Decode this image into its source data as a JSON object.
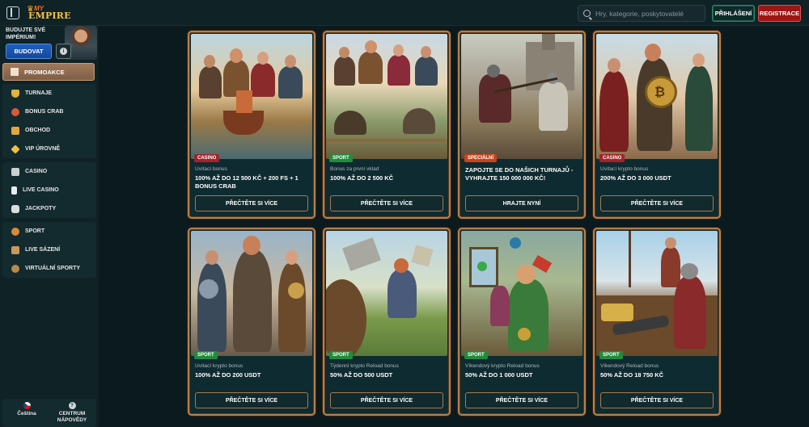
{
  "header": {
    "logo_top": "MY",
    "logo_main": "EMPIRE",
    "search_placeholder": "Hry, kategorie, poskytovatelé",
    "login_label": "PŘIHLÁŠENÍ",
    "register_label": "REGISTRACE"
  },
  "sidebar": {
    "build_text": "BUDUJTE SVÉ IMPÉRIUM!",
    "build_button": "BUDOVAT",
    "active_item": "PROMOAKCE",
    "group1": [
      "TURNAJE",
      "BONUS CRAB",
      "OBCHOD",
      "VIP ÚROVNĚ"
    ],
    "group2": [
      "CASINO",
      "LIVE CASINO",
      "JACKPOTY"
    ],
    "group3": [
      "SPORT",
      "LIVE SÁZENÍ",
      "VIRTUÁLNÍ SPORTY"
    ],
    "language": "Čeština",
    "help_line1": "CENTRUM",
    "help_line2": "NÁPOVĚDY"
  },
  "cards": [
    {
      "tag": "CASINO",
      "subtitle": "Uvítací bonus",
      "title": "100% AŽ DO 12 500 KČ + 200 FS + 1 BONUS CRAB",
      "cta": "PŘEČTĚTE SI VÍCE"
    },
    {
      "tag": "SPORT",
      "subtitle": "Bonus za první vklad",
      "title": "100% AŽ DO 2 500 KČ",
      "cta": "PŘEČTĚTE SI VÍCE"
    },
    {
      "tag": "SPECIÁLNÍ",
      "subtitle": "",
      "title": "ZAPOJTE SE DO NAŠICH TURNAJŮ - VYHRAJTE 150 000 000 KČ!",
      "cta": "HRAJTE NYNÍ"
    },
    {
      "tag": "CASINO",
      "subtitle": "Uvítací krypto bonus",
      "title": "200% AŽ DO 3 000 USDT",
      "cta": "PŘEČTĚTE SI VÍCE"
    },
    {
      "tag": "SPORT",
      "subtitle": "Uvítací krypto bonus",
      "title": "100% AŽ DO 200 USDT",
      "cta": "PŘEČTĚTE SI VÍCE"
    },
    {
      "tag": "SPORT",
      "subtitle": "Týdenní krypto Reload bonus",
      "title": "50% AŽ DO 500 USDT",
      "cta": "PŘEČTĚTE SI VÍCE"
    },
    {
      "tag": "SPORT",
      "subtitle": "Víkendový krypto Reload bonus",
      "title": "50% AŽ DO 1 000 USDT",
      "cta": "PŘEČTĚTE SI VÍCE"
    },
    {
      "tag": "SPORT",
      "subtitle": "Víkendový Reload bonus",
      "title": "50% AŽ DO 18 750 KČ",
      "cta": "PŘEČTĚTE SI VÍCE"
    }
  ],
  "colors": {
    "background": "#0b1a1e",
    "card_border": "#b8804a",
    "casino_tag": "#a3232a",
    "sport_tag": "#238a3c",
    "special_tag": "#c5441a",
    "register": "#a01616",
    "login_border": "#1f8a6a"
  }
}
